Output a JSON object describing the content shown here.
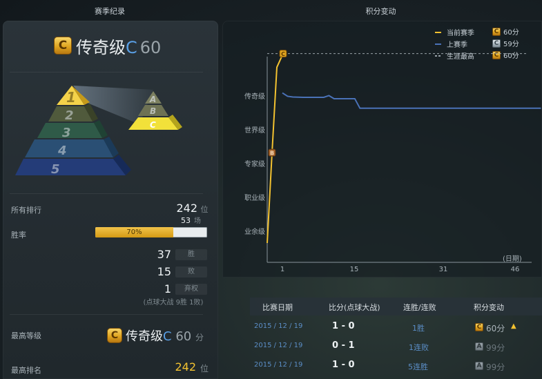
{
  "left_title": "赛季纪录",
  "right_title": "积分变动",
  "tier": {
    "badge_letter": "C",
    "name": "传奇级",
    "grade": "C",
    "points": "60",
    "pyramid_main": [
      "1",
      "2",
      "3",
      "4",
      "5"
    ],
    "pyramid_side": [
      "A",
      "B",
      "C"
    ]
  },
  "stats": {
    "rank_label": "所有排行",
    "rank_value": "242",
    "rank_unit": "位",
    "games_value": "53",
    "games_unit": "场",
    "winrate_label": "胜率",
    "winrate_text": "70%",
    "winrate_value": 0.7,
    "wins": "37",
    "wins_unit": "胜",
    "losses": "15",
    "losses_unit": "败",
    "forfeits": "1",
    "forfeits_unit": "弃权",
    "penalty_note": "(点球大战 9胜 1败)"
  },
  "best": {
    "tier_label": "最高等级",
    "tier_name": "传奇级",
    "tier_grade": "C",
    "tier_points": "60",
    "tier_unit": "分",
    "rank_label": "最高排名",
    "rank_value": "242",
    "rank_unit": "位"
  },
  "legend": [
    {
      "name": "当前赛季",
      "color": "#f3c230",
      "style": "solid",
      "badge": "C",
      "value": "60分"
    },
    {
      "name": "上赛季",
      "color": "#4a72b8",
      "style": "solid",
      "badge": "C",
      "value": "59分"
    },
    {
      "name": "生涯最高",
      "color": "#9aa4aa",
      "style": "dashed",
      "badge": "C",
      "value": "60分"
    }
  ],
  "chart_data": {
    "type": "line",
    "y_categories": [
      "业余级",
      "职业级",
      "专家级",
      "世界级",
      "传奇级"
    ],
    "x_ticks": [
      1,
      15,
      31,
      46
    ],
    "x_unit": "(日期)",
    "series": [
      {
        "name": "当前赛季",
        "color": "#f3c230",
        "x": [
          0,
          1,
          2,
          3
        ],
        "y": [
          -0.3,
          2.3,
          4.8,
          5.2
        ],
        "markers": [
          {
            "x": 1,
            "label": "B"
          },
          {
            "x": 3,
            "label": "C"
          }
        ]
      },
      {
        "name": "上赛季",
        "color": "#4a72b8",
        "x": [
          1,
          2,
          3,
          5,
          7,
          9,
          10,
          11,
          13,
          15,
          16,
          20,
          25,
          31,
          40,
          46,
          51
        ],
        "y": [
          4.05,
          3.95,
          3.93,
          3.92,
          3.92,
          3.92,
          3.97,
          3.88,
          3.88,
          3.88,
          3.6,
          3.6,
          3.6,
          3.6,
          3.6,
          3.6,
          3.6
        ]
      },
      {
        "name": "生涯最高",
        "color": "#9aa4aa",
        "style": "dashed",
        "y": 5.2
      }
    ]
  },
  "table": {
    "headers": [
      "比赛日期",
      "比分(点球大战)",
      "连胜/连败",
      "积分变动"
    ],
    "rows": [
      {
        "date": "2015 / 12 / 19",
        "score": "1 - 0",
        "streak": "1胜",
        "badge": "C",
        "points": "60分",
        "trend": "up",
        "badge_style": "gold"
      },
      {
        "date": "2015 / 12 / 19",
        "score": "0 - 1",
        "streak": "1连败",
        "badge": "A",
        "points": "99分",
        "trend": "",
        "badge_style": "dim"
      },
      {
        "date": "2015 / 12 / 19",
        "score": "1 - 0",
        "streak": "5连胜",
        "badge": "A",
        "points": "99分",
        "trend": "",
        "badge_style": "dim"
      }
    ]
  }
}
